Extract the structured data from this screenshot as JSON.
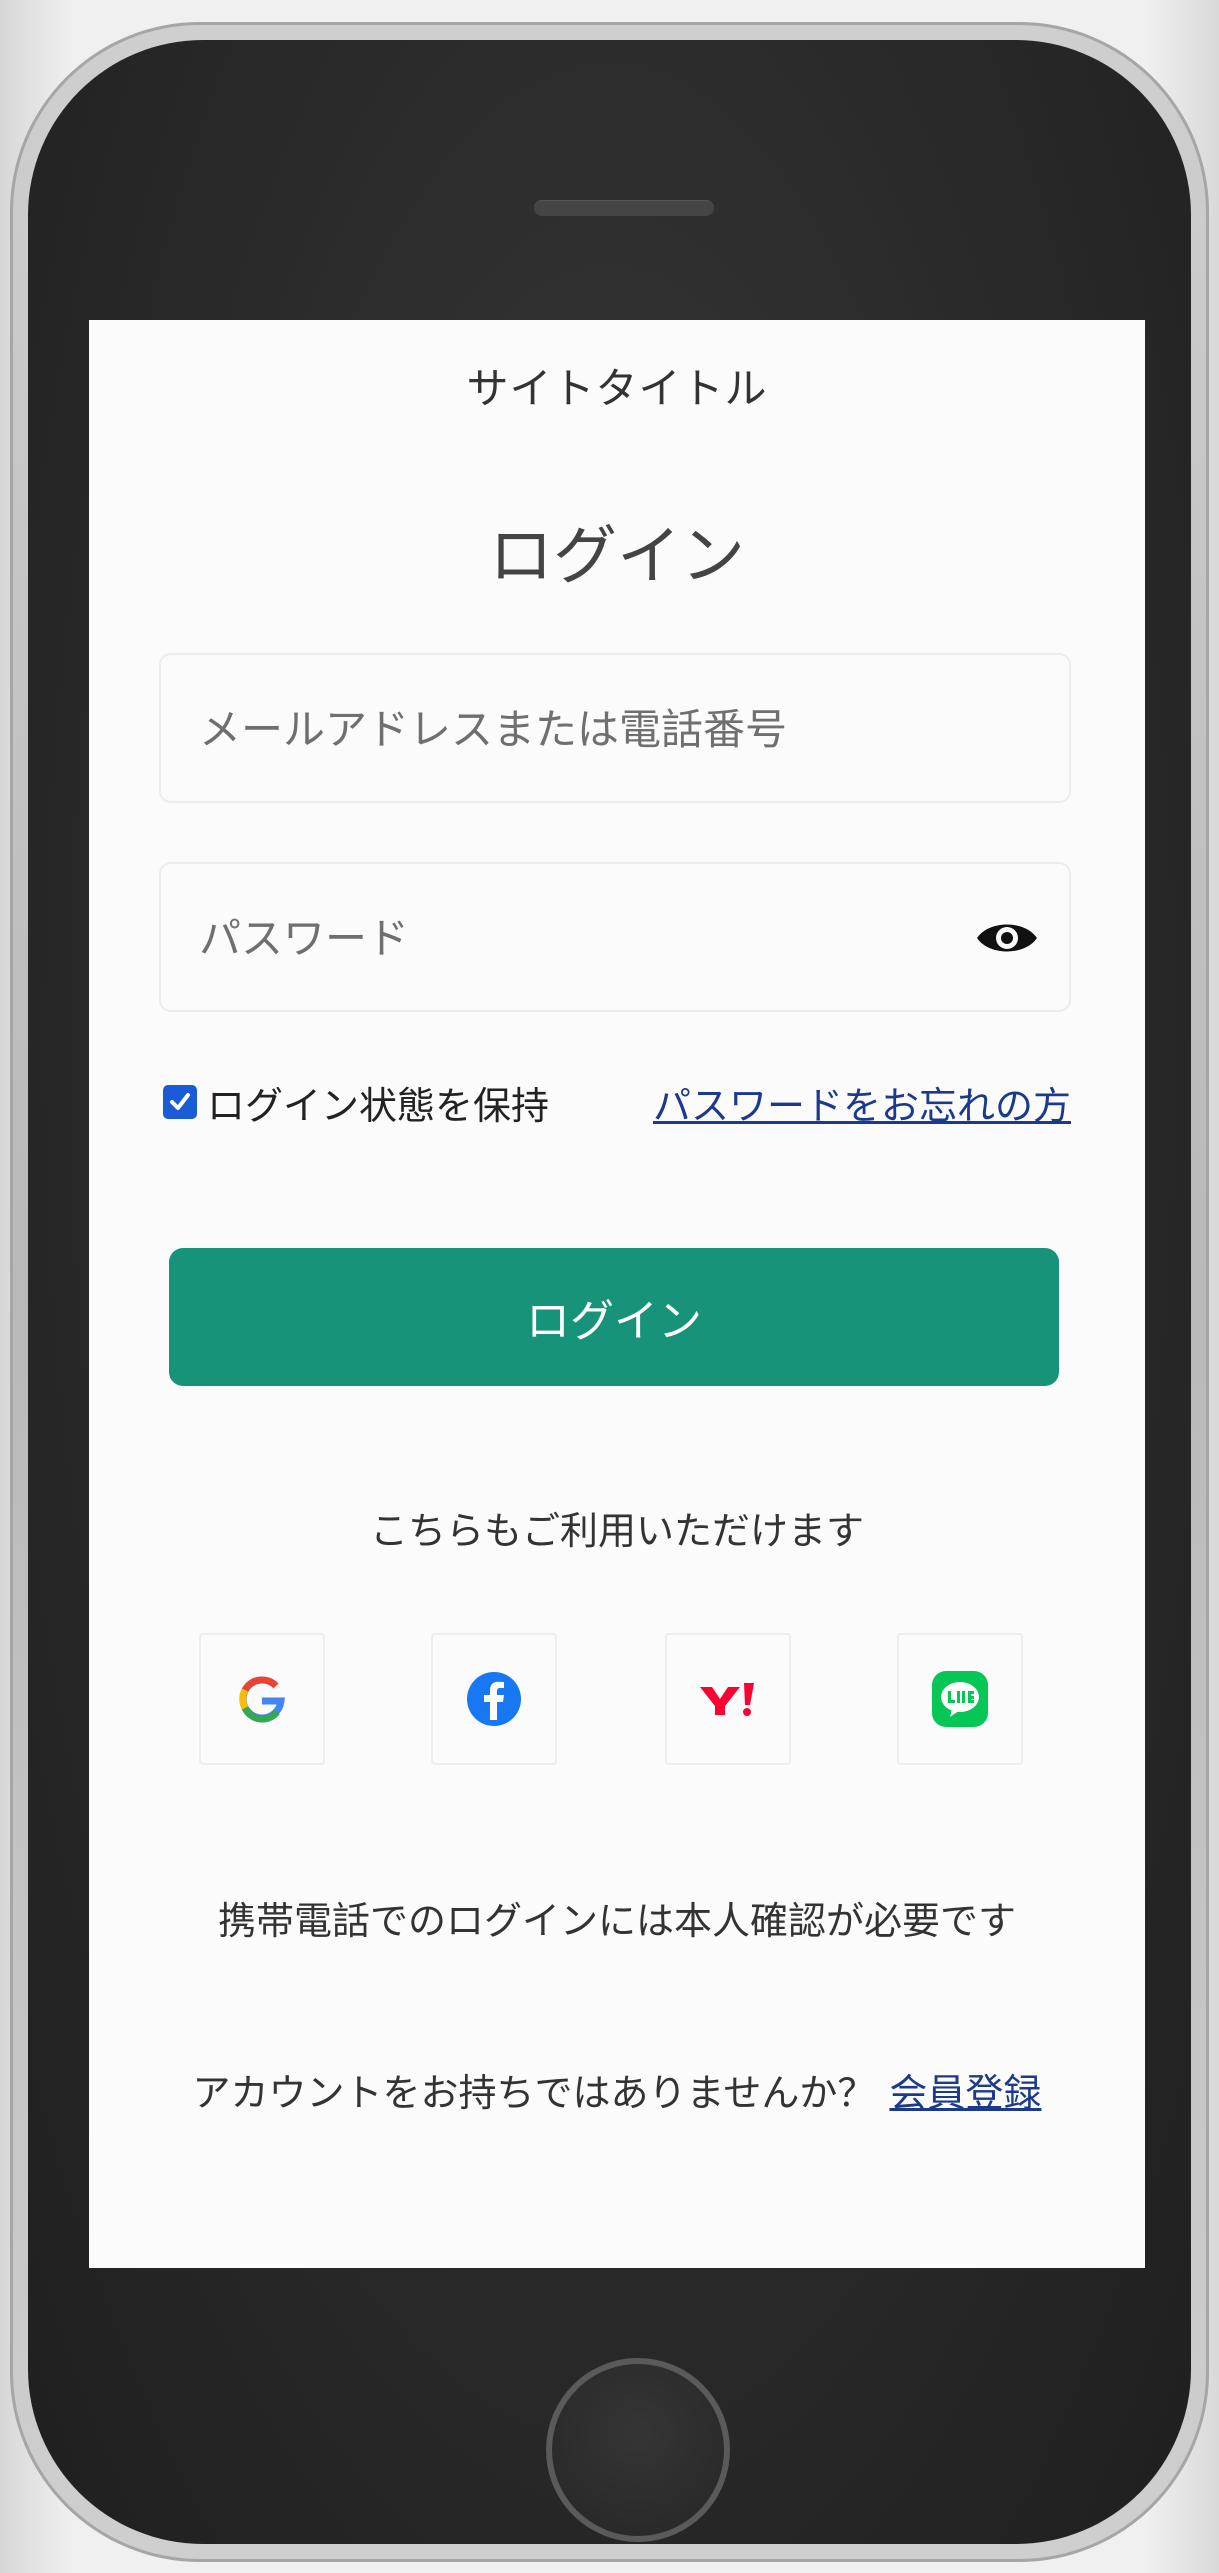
{
  "header": {
    "site_title": "サイトタイトル"
  },
  "form": {
    "title": "ログイン",
    "email_placeholder": "メールアドレスまたは電話番号",
    "email_value": "",
    "password_placeholder": "パスワード",
    "password_value": "",
    "password_toggle_icon": "eye-icon",
    "remember_label": "ログイン状態を保持",
    "remember_checked": true,
    "forgot_link": "パスワードをお忘れの方",
    "submit_label": "ログイン"
  },
  "social": {
    "intro": "こちらもご利用いただけます",
    "providers": [
      {
        "name": "Google",
        "icon": "google-icon"
      },
      {
        "name": "Facebook",
        "icon": "facebook-icon"
      },
      {
        "name": "Yahoo",
        "icon": "yahoo-icon"
      },
      {
        "name": "LINE",
        "icon": "line-icon"
      }
    ]
  },
  "footer": {
    "phone_notice": "携帯電話でのログインには本人確認が必要です",
    "no_account_text": "アカウントをお持ちではありませんか？",
    "signup_link": "会員登録"
  },
  "colors": {
    "primary_button": "#17937a",
    "link": "#1c3a8c",
    "checkbox": "#1a5bd6"
  }
}
